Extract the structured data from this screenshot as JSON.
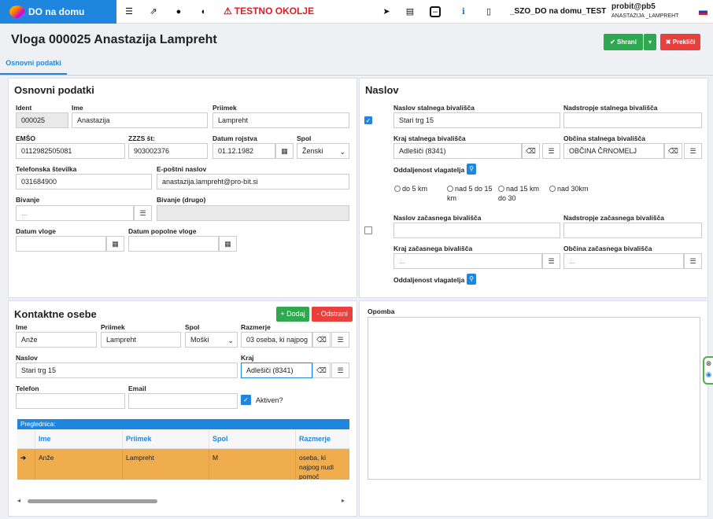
{
  "topbar": {
    "brand": "DO na domu",
    "environment": "TESTNO OKOLJE",
    "system": "_SZO_DO na domu_TEST",
    "user_login": "probit@pb5",
    "user_name": "ANASTAZIJA _LAMPREHT"
  },
  "header": {
    "title": "Vloga 000025 Anastazija Lampreht",
    "save_label": "Shrani",
    "cancel_label": "Prekliči",
    "tab": "Osnovni podatki"
  },
  "basic": {
    "title": "Osnovni podatki",
    "ident_label": "Ident",
    "ident": "000025",
    "ime_label": "Ime",
    "ime": "Anastazija",
    "priimek_label": "Priimek",
    "priimek": "Lampreht",
    "emso_label": "EMŠO",
    "emso": "0112982505081",
    "zzzs_label": "ZZZS št:",
    "zzzs": "903002376",
    "dob_label": "Datum rojstva",
    "dob": "01.12.1982",
    "spol_label": "Spol",
    "spol": "Ženski",
    "phone_label": "Telefonska številka",
    "phone": "031684900",
    "email_label": "E-poštni naslov",
    "email": "anastazija.lampreht@pro-bit.si",
    "bivanje_label": "Bivanje",
    "bivanje_placeholder": "...",
    "bivanje2_label": "Bivanje (drugo)",
    "datum_vloge_label": "Datum vloge",
    "datum_popolne_label": "Datum popolne vloge"
  },
  "address": {
    "title": "Naslov",
    "perm_label": "Naslov stalnega bivališča",
    "perm": "Stari trg 15",
    "perm_extra_label": "Nadstropje stalnega bivališča",
    "perm_city_label": "Kraj stalnega bivališča",
    "perm_city": "Adlešiči (8341)",
    "perm_muni_label": "Občina stalnega bivališča",
    "perm_muni": "OBČINA ČRNOMELJ",
    "distance_label": "Oddaljenost vlagatelja",
    "radios": [
      "do 5 km",
      "nad 5 do 15 km",
      "nad 15 km do 30",
      "nad 30km"
    ],
    "temp_label": "Naslov začasnega bivališča",
    "temp_extra_label": "Nadstropje začasnega bivališča",
    "temp_city_label": "Kraj začasnega bivališča",
    "temp_city_placeholder": "...",
    "temp_muni_label": "Občina začasnega bivališča",
    "temp_muni_placeholder": "...",
    "distance2_label": "Oddaljenost vlagatelja"
  },
  "contacts": {
    "title": "Kontaktne osebe",
    "add_label": "+ Dodaj",
    "remove_label": "- Odstrani",
    "ime_label": "Ime",
    "ime": "Anže",
    "priimek_label": "Priimek",
    "priimek": "Lampreht",
    "spol_label": "Spol",
    "spol": "Moški",
    "razmerje_label": "Razmerje",
    "razmerje": "03 oseba, ki najpog",
    "naslov_label": "Naslov",
    "naslov": "Stari trg 15",
    "kraj_label": "Kraj",
    "kraj": "Adlešiči (8341)",
    "telefon_label": "Telefon",
    "email_label": "Email",
    "active_label": "Aktiven?",
    "grid_title": "Preglednica:",
    "columns": [
      "Ime",
      "Priimek",
      "Spol",
      "Razmerje"
    ],
    "row": {
      "ime": "Anže",
      "priimek": "Lampreht",
      "spol": "M",
      "razmerje": "oseba, ki najpog nudi pomoč"
    }
  },
  "note": {
    "label": "Opomba"
  }
}
